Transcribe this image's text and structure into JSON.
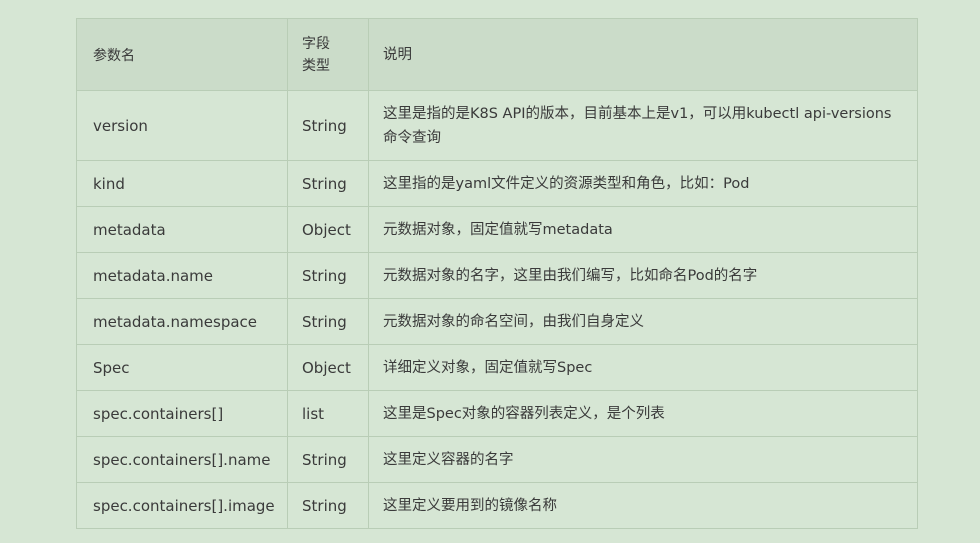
{
  "table": {
    "headers": {
      "name": "参数名",
      "type_line1": "字段",
      "type_line2": "类型",
      "desc": "说明"
    },
    "rows": [
      {
        "name": "version",
        "type": "String",
        "desc": "这里是指的是K8S API的版本，目前基本上是v1，可以用kubectl api-versions命令查询"
      },
      {
        "name": "kind",
        "type": "String",
        "desc": "这里指的是yaml文件定义的资源类型和角色，比如：Pod"
      },
      {
        "name": "metadata",
        "type": "Object",
        "desc": "元数据对象，固定值就写metadata"
      },
      {
        "name": "metadata.name",
        "type": "String",
        "desc": "元数据对象的名字，这里由我们编写，比如命名Pod的名字"
      },
      {
        "name": "metadata.namespace",
        "type": "String",
        "desc": "元数据对象的命名空间，由我们自身定义"
      },
      {
        "name": "Spec",
        "type": "Object",
        "desc": "详细定义对象，固定值就写Spec"
      },
      {
        "name": "spec.containers[]",
        "type": "list",
        "desc": "这里是Spec对象的容器列表定义，是个列表"
      },
      {
        "name": "spec.containers[].name",
        "type": "String",
        "desc": "这里定义容器的名字"
      },
      {
        "name": "spec.containers[].image",
        "type": "String",
        "desc": "这里定义要用到的镜像名称"
      }
    ]
  }
}
